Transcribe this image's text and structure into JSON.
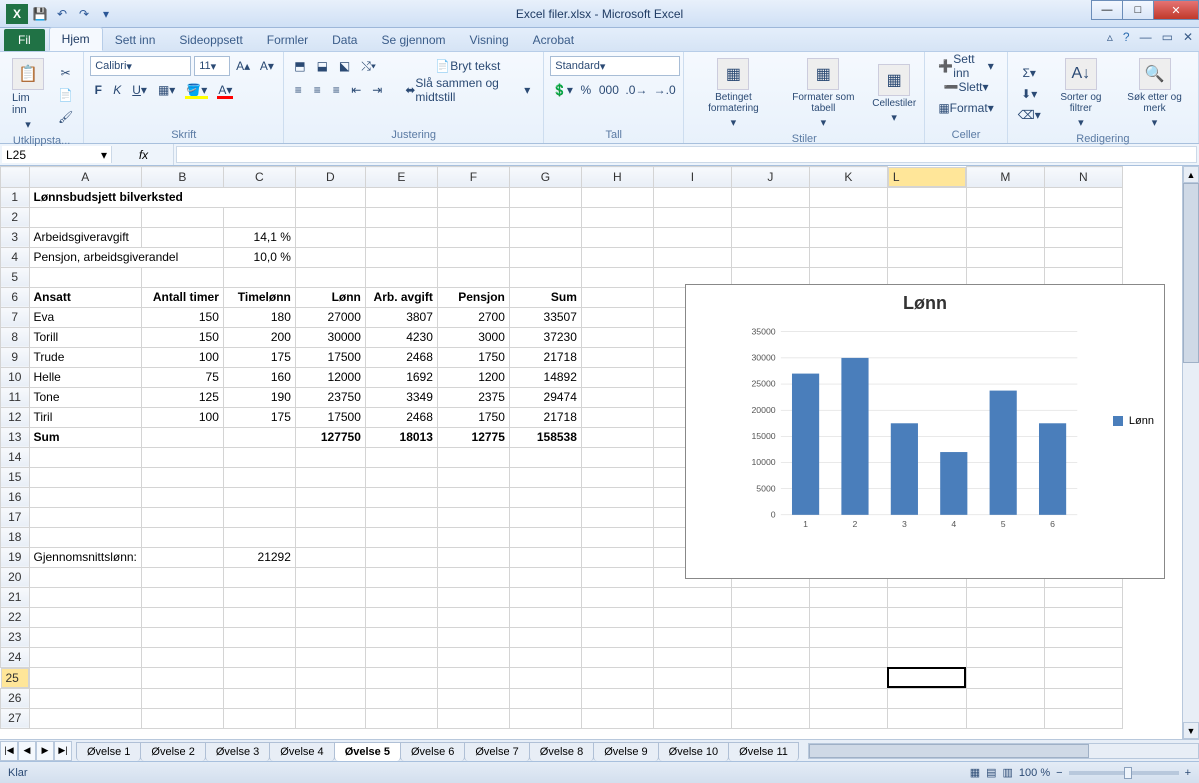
{
  "title": "Excel filer.xlsx - Microsoft Excel",
  "qat": [
    "save-icon",
    "undo-icon",
    "redo-icon"
  ],
  "ribbon_tabs": [
    "Fil",
    "Hjem",
    "Sett inn",
    "Sideoppsett",
    "Formler",
    "Data",
    "Se gjennom",
    "Visning",
    "Acrobat"
  ],
  "active_tab": "Hjem",
  "namebox": "L25",
  "formula": "",
  "groups": {
    "clipboard": {
      "label": "Utklippsta...",
      "paste": "Lim inn"
    },
    "font": {
      "label": "Skrift",
      "name": "Calibri",
      "size": "11"
    },
    "align": {
      "label": "Justering",
      "wrap": "Bryt tekst",
      "merge": "Slå sammen og midtstill"
    },
    "number": {
      "label": "Tall",
      "format": "Standard"
    },
    "styles": {
      "label": "Stiler",
      "cond": "Betinget formatering",
      "astable": "Formater som tabell",
      "cellstyles": "Cellestiler"
    },
    "cells": {
      "label": "Celler",
      "insert": "Sett inn",
      "delete": "Slett",
      "format": "Format"
    },
    "edit": {
      "label": "Redigering",
      "sort": "Sorter og filtrer",
      "find": "Søk etter og merk"
    }
  },
  "columns": [
    "A",
    "B",
    "C",
    "D",
    "E",
    "F",
    "G",
    "H",
    "I",
    "J",
    "K",
    "L",
    "M",
    "N"
  ],
  "selected_col": "L",
  "selected_row": 25,
  "sheet": {
    "r1": {
      "A": "Lønnsbudsjett bilverksted"
    },
    "r3": {
      "A": "Arbeidsgiveravgift",
      "C": "14,1 %"
    },
    "r4": {
      "A": "Pensjon, arbeidsgiverandel",
      "C": "10,0 %"
    },
    "r6": {
      "A": "Ansatt",
      "B": "Antall timer",
      "C": "Timelønn",
      "D": "Lønn",
      "E": "Arb. avgift",
      "F": "Pensjon",
      "G": "Sum"
    },
    "r7": {
      "A": "Eva",
      "B": "150",
      "C": "180",
      "D": "27000",
      "E": "3807",
      "F": "2700",
      "G": "33507"
    },
    "r8": {
      "A": "Torill",
      "B": "150",
      "C": "200",
      "D": "30000",
      "E": "4230",
      "F": "3000",
      "G": "37230"
    },
    "r9": {
      "A": "Trude",
      "B": "100",
      "C": "175",
      "D": "17500",
      "E": "2468",
      "F": "1750",
      "G": "21718"
    },
    "r10": {
      "A": "Helle",
      "B": "75",
      "C": "160",
      "D": "12000",
      "E": "1692",
      "F": "1200",
      "G": "14892"
    },
    "r11": {
      "A": "Tone",
      "B": "125",
      "C": "190",
      "D": "23750",
      "E": "3349",
      "F": "2375",
      "G": "29474"
    },
    "r12": {
      "A": "Tiril",
      "B": "100",
      "C": "175",
      "D": "17500",
      "E": "2468",
      "F": "1750",
      "G": "21718"
    },
    "r13": {
      "A": "Sum",
      "D": "127750",
      "E": "18013",
      "F": "12775",
      "G": "158538"
    },
    "r19": {
      "A": "Gjennomsnittslønn:",
      "C": "21292"
    }
  },
  "chart_data": {
    "type": "bar",
    "title": "Lønn",
    "categories": [
      "1",
      "2",
      "3",
      "4",
      "5",
      "6"
    ],
    "series": [
      {
        "name": "Lønn",
        "values": [
          27000,
          30000,
          17500,
          12000,
          23750,
          17500
        ]
      }
    ],
    "ylim": [
      0,
      35000
    ],
    "ytick": 5000,
    "legend": "Lønn",
    "color": "#4a7ebb"
  },
  "sheet_tabs": [
    "Øvelse 1",
    "Øvelse 2",
    "Øvelse 3",
    "Øvelse 4",
    "Øvelse 5",
    "Øvelse 6",
    "Øvelse 7",
    "Øvelse 8",
    "Øvelse 9",
    "Øvelse 10",
    "Øvelse 11"
  ],
  "active_sheet": "Øvelse 5",
  "status": {
    "ready": "Klar",
    "zoom": "100 %"
  }
}
